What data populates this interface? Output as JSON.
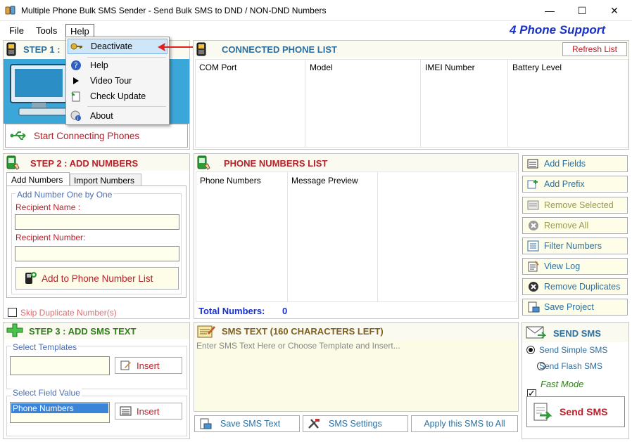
{
  "window": {
    "title": "Multiple Phone Bulk SMS Sender - Send Bulk SMS to DND / NON-DND Numbers",
    "minimize": "—",
    "maximize": "☐",
    "close": "✕"
  },
  "menu": {
    "file": "File",
    "tools": "Tools",
    "help": "Help",
    "support": "4 Phone Support"
  },
  "help_menu": {
    "deactivate": "Deactivate",
    "help": "Help",
    "video_tour": "Video Tour",
    "check_update": "Check Update",
    "about": "About"
  },
  "step1": {
    "title": "STEP 1 :",
    "connect_button": "Start Connecting Phones"
  },
  "connected": {
    "title": "CONNECTED PHONE LIST",
    "refresh": "Refresh List",
    "columns": [
      "COM  Port",
      "Model",
      "IMEI Number",
      "Battery Level"
    ]
  },
  "step2": {
    "title": "STEP 2 : ADD NUMBERS",
    "tab_add": "Add Numbers",
    "tab_import": "Import Numbers",
    "group": "Add Number One by One",
    "recipient_name": "Recipient Name :",
    "recipient_number": "Recipient Number:",
    "add_button": "Add to Phone Number List",
    "skip_dup": "Skip Duplicate Number(s)"
  },
  "phone_list": {
    "title": "PHONE NUMBERS LIST",
    "columns": [
      "Phone Numbers",
      "Message Preview"
    ],
    "total_label": "Total Numbers:",
    "total_value": "0"
  },
  "side_buttons": {
    "add_fields": "Add Fields",
    "add_prefix": "Add Prefix",
    "remove_selected": "Remove Selected",
    "remove_all": "Remove All",
    "filter": "Filter Numbers",
    "view_log": "View Log",
    "remove_dup": "Remove Duplicates",
    "save_project": "Save Project"
  },
  "step3": {
    "title": "STEP 3 : ADD SMS TEXT",
    "templates": "Select Templates",
    "insert": "Insert",
    "field_value": "Select Field Value",
    "field_selected": "Phone Numbers"
  },
  "sms_text": {
    "title": "SMS TEXT (160 CHARACTERS LEFT)",
    "placeholder": "Enter SMS Text Here or Choose Template and Insert...",
    "save": "Save SMS Text",
    "settings": "SMS Settings",
    "apply": "Apply this SMS to All"
  },
  "send": {
    "title": "SEND SMS",
    "simple": "Send Simple SMS",
    "flash": "Send Flash SMS",
    "fast": "Fast Mode",
    "button": "Send SMS"
  },
  "colors": {
    "accent_blue": "#1a31c9",
    "title_red": "#b8202a",
    "title_green": "#2f7f19",
    "title_blue": "#2d6f9f"
  }
}
